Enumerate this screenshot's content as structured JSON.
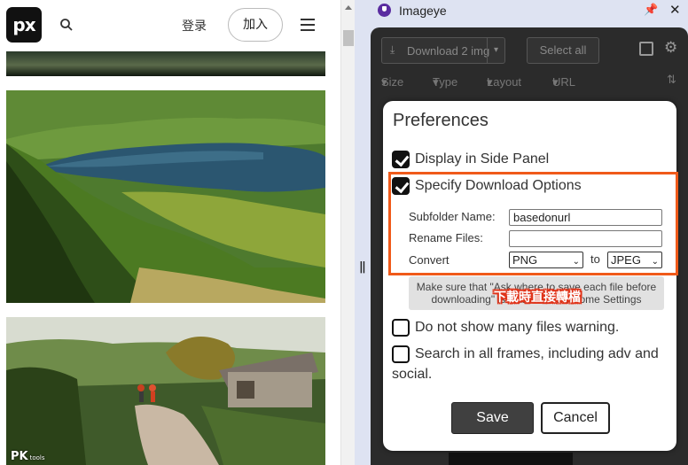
{
  "site": {
    "logo_text": "px",
    "login_label": "登录",
    "join_label": "加入"
  },
  "watermark": {
    "main": "PK",
    "sub": "tools"
  },
  "panel": {
    "title": "Imageye"
  },
  "toolbar": {
    "download_label": "Download 2 img",
    "select_all_label": "Select all",
    "filters": [
      "Size",
      "Type",
      "Layout",
      "URL"
    ]
  },
  "preferences": {
    "title": "Preferences",
    "display_side_panel": {
      "label": "Display in Side Panel",
      "checked": true
    },
    "specify_download": {
      "label": "Specify Download Options",
      "checked": true
    },
    "subfolder": {
      "label": "Subfolder Name:",
      "value": "basedonurl"
    },
    "rename": {
      "label": "Rename Files:",
      "value": ""
    },
    "convert": {
      "label": "Convert",
      "from": "PNG",
      "to_label": "to",
      "to": "JPEG"
    },
    "note_line1": "Make sure that \"Ask where to save each file before",
    "note_line2": "downloading\" is disabled in Chrome Settings",
    "overlay": "下載時直接轉檔",
    "many_files_warning": {
      "label": "Do not show many files warning.",
      "checked": false
    },
    "all_frames": {
      "label1": "Search in all frames, including adv and",
      "label2": "social.",
      "checked": false
    },
    "save_label": "Save",
    "cancel_label": "Cancel"
  },
  "colors": {
    "highlight": "#f05a1a",
    "overlay_stroke": "#e0341a",
    "panel_bg": "#dee3f2",
    "app_bg": "#2b2b2b"
  }
}
